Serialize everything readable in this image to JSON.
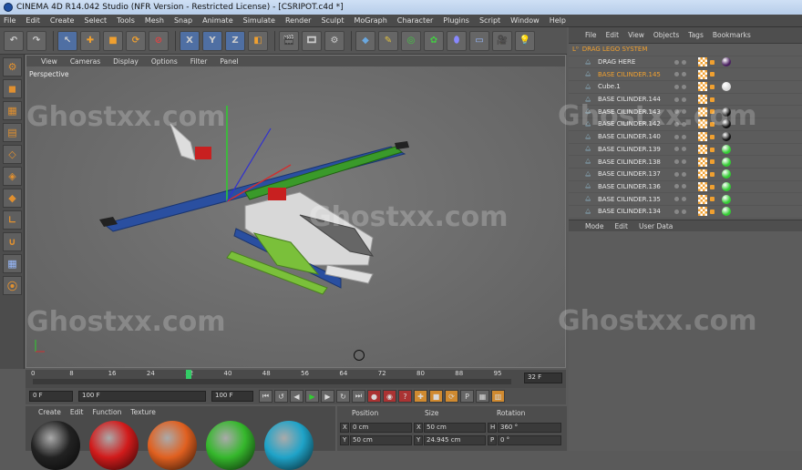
{
  "window": {
    "title": "CINEMA 4D R14.042 Studio (NFR Version - Restricted License) - [CSRIPOT.c4d *]"
  },
  "menubar": [
    "File",
    "Edit",
    "Create",
    "Select",
    "Tools",
    "Mesh",
    "Snap",
    "Animate",
    "Simulate",
    "Render",
    "Sculpt",
    "MoGraph",
    "Character",
    "Plugins",
    "Script",
    "Window",
    "Help"
  ],
  "toolbar": {
    "buttons": [
      "undo-icon",
      "redo-icon",
      "select-icon",
      "move-icon",
      "scale-icon",
      "rotate-icon",
      "live-select-icon",
      "x-axis-lock",
      "y-axis-lock",
      "z-axis-lock",
      "coordinate-system-icon",
      "render-view-icon",
      "render-picture-viewer-icon",
      "edit-render-settings-icon",
      "cube-icon",
      "spline-pen-icon",
      "subdivision-icon",
      "cloner-icon",
      "deformer-icon",
      "floor-icon",
      "camera-icon",
      "light-icon"
    ],
    "axis_labels": [
      "X",
      "Y",
      "Z"
    ]
  },
  "viewport": {
    "menu": [
      "View",
      "Cameras",
      "Display",
      "Options",
      "Filter",
      "Panel"
    ],
    "label": "Perspective"
  },
  "watermark": "Ghostxx.com",
  "timeline": {
    "ticks": [
      "0",
      "8",
      "16",
      "24",
      "32",
      "40",
      "48",
      "56",
      "64",
      "72",
      "80",
      "88",
      "95"
    ],
    "current_frame": "32 F",
    "start": "0 F",
    "min_field": "0 F",
    "max_field": "100 F",
    "end_field": "100 F"
  },
  "materials": {
    "menu": [
      "Create",
      "Edit",
      "Function",
      "Texture"
    ],
    "swatches": [
      "#222222",
      "#d11b1b",
      "#e06020",
      "#35b72c",
      "#1fa3c8"
    ]
  },
  "coordinates": {
    "headers": [
      "Position",
      "Size",
      "Rotation"
    ],
    "rows": [
      {
        "axis": "X",
        "pos": "0 cm",
        "size_axis": "X",
        "size": "50 cm",
        "rot_axis": "H",
        "rot": "360 °"
      },
      {
        "axis": "Y",
        "pos": "50 cm",
        "size_axis": "Y",
        "size": "24.945 cm",
        "rot_axis": "P",
        "rot": "0 °"
      }
    ]
  },
  "object_manager": {
    "menu": [
      "File",
      "Edit",
      "View",
      "Objects",
      "Tags",
      "Bookmarks"
    ],
    "parent": "DRAG LEGO SYSTEM",
    "items": [
      {
        "name": "DRAG HERE",
        "tag": "material-purple"
      },
      {
        "name": "BASE CILINDER.145",
        "selected": true,
        "tag": "none"
      },
      {
        "name": "Cube.1",
        "tag": "material-white"
      },
      {
        "name": "BASE CILINDER.144",
        "tag": "none"
      },
      {
        "name": "BASE CILINDER.143",
        "tag": "material-black"
      },
      {
        "name": "BASE CILINDER.142",
        "tag": "material-black"
      },
      {
        "name": "BASE CILINDER.140",
        "tag": "material-black"
      },
      {
        "name": "BASE CILINDER.139",
        "tag": "material-green"
      },
      {
        "name": "BASE CILINDER.138",
        "tag": "material-green"
      },
      {
        "name": "BASE CILINDER.137",
        "tag": "material-green"
      },
      {
        "name": "BASE CILINDER.136",
        "tag": "material-green"
      },
      {
        "name": "BASE CILINDER.135",
        "tag": "material-green"
      },
      {
        "name": "BASE CILINDER.134",
        "tag": "material-green"
      }
    ]
  },
  "attributes": {
    "menu": [
      "Mode",
      "Edit",
      "User Data"
    ]
  },
  "colors": {
    "accent": "#f0a030",
    "selection": "#4f6fa3"
  }
}
